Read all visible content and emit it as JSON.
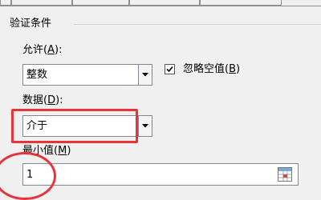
{
  "group": {
    "title": "验证条件"
  },
  "allow": {
    "label": "允许",
    "accel": "A",
    "value": "整数"
  },
  "ignore_blank": {
    "label": "忽略空值",
    "accel": "B",
    "checked": true
  },
  "data": {
    "label": "数据",
    "accel": "D",
    "value": "介于"
  },
  "minimum": {
    "label": "最小值",
    "accel": "M",
    "value": "1"
  },
  "annotation_color": "#e8333a"
}
